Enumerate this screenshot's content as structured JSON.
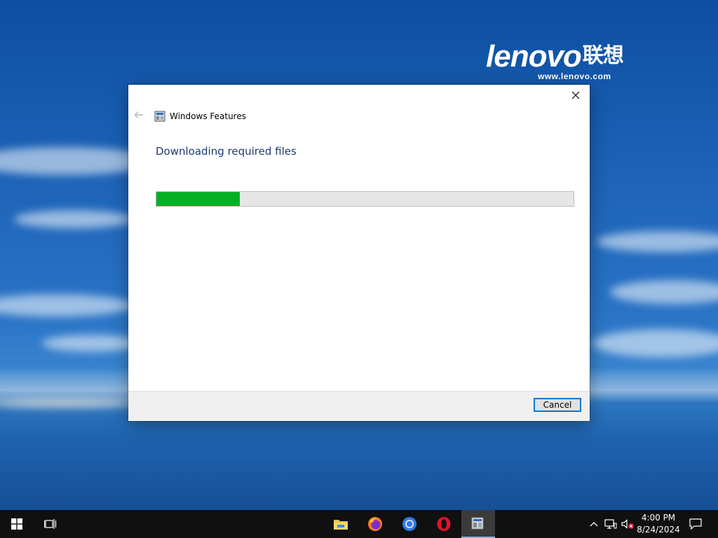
{
  "desktop": {
    "brand": "lenovo",
    "brand_cn": "联想",
    "brand_url": "www.lenovo.com"
  },
  "dialog": {
    "title": "Windows Features",
    "heading": "Downloading required files",
    "progress_percent": 20,
    "cancel_label": "Cancel",
    "close_icon": "close-icon",
    "back_icon": "back-arrow-icon",
    "accent_color": "#0078d7",
    "progress_color": "#06b025",
    "heading_color": "#1f3b73"
  },
  "taskbar": {
    "start_icon": "windows-start-icon",
    "task_view_icon": "task-view-icon",
    "pinned_apps": [
      "file-explorer-icon",
      "firefox-icon",
      "chrome-icon",
      "opera-icon",
      "windows-features-icon"
    ],
    "active_app": "windows-features-icon",
    "tray_icons": [
      "chevron-up-icon",
      "network-icon",
      "volume-muted-icon"
    ],
    "time": "4:00 PM",
    "date": "8/24/2024",
    "notification_icon": "action-center-icon"
  }
}
